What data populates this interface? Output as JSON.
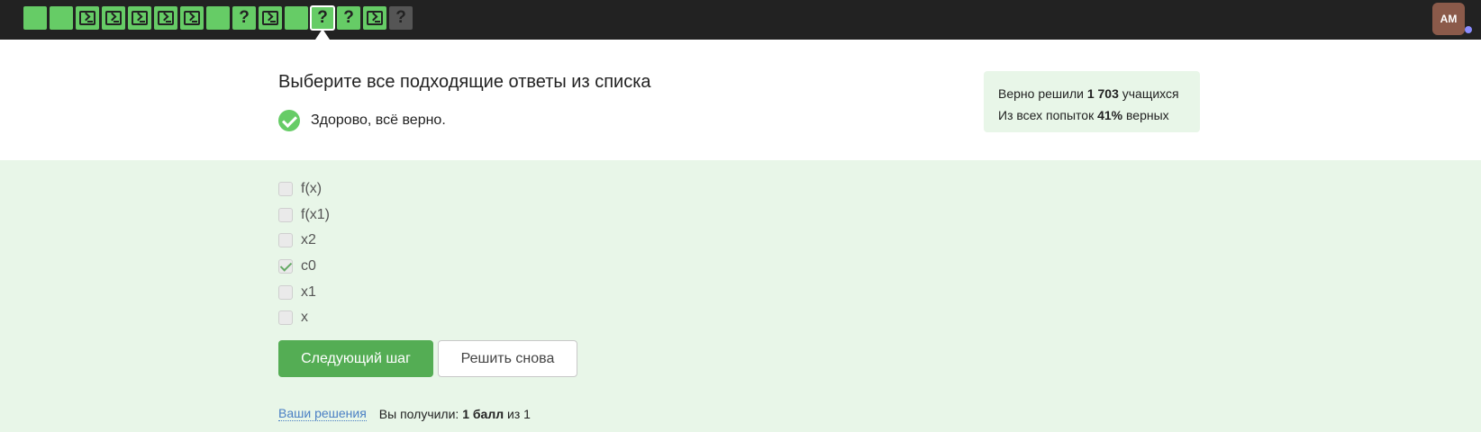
{
  "steps": [
    {
      "type": "filled",
      "state": "done"
    },
    {
      "type": "filled",
      "state": "done"
    },
    {
      "type": "code",
      "state": "done"
    },
    {
      "type": "code",
      "state": "done"
    },
    {
      "type": "code",
      "state": "done"
    },
    {
      "type": "code",
      "state": "done"
    },
    {
      "type": "code",
      "state": "done"
    },
    {
      "type": "filled",
      "state": "done"
    },
    {
      "type": "quiz",
      "state": "done",
      "glyph": "?"
    },
    {
      "type": "code",
      "state": "done"
    },
    {
      "type": "filled",
      "state": "done"
    },
    {
      "type": "quiz",
      "state": "active",
      "glyph": "?"
    },
    {
      "type": "quiz",
      "state": "done",
      "glyph": "?"
    },
    {
      "type": "code",
      "state": "done"
    },
    {
      "type": "quiz",
      "state": "locked",
      "glyph": "?"
    }
  ],
  "user": {
    "initials": "AM"
  },
  "question": {
    "title": "Выберите все подходящие ответы из списка",
    "result_text": "Здорово, всё верно."
  },
  "stats": {
    "line1_prefix": "Верно решили",
    "line1_value": "1 703",
    "line1_suffix": "учащихся",
    "line2_prefix": "Из всех попыток",
    "line2_value": "41%",
    "line2_suffix": "верных"
  },
  "options": [
    {
      "label": "f(x)",
      "checked": false
    },
    {
      "label": "f(x1)",
      "checked": false
    },
    {
      "label": "x2",
      "checked": false
    },
    {
      "label": "c0",
      "checked": true
    },
    {
      "label": "x1",
      "checked": false
    },
    {
      "label": "x",
      "checked": false
    }
  ],
  "buttons": {
    "next": "Следующий шаг",
    "retry": "Решить снова"
  },
  "footer": {
    "solutions_link": "Ваши решения",
    "score_prefix": "Вы получили:",
    "score_value": "1 балл",
    "score_suffix": "из 1"
  },
  "colors": {
    "topbar": "#222222",
    "step_done": "#66cc66",
    "step_locked": "#555555",
    "accent_button": "#54ad54",
    "page_success_bg": "#e8f6e8",
    "link": "#4a7fc4"
  }
}
